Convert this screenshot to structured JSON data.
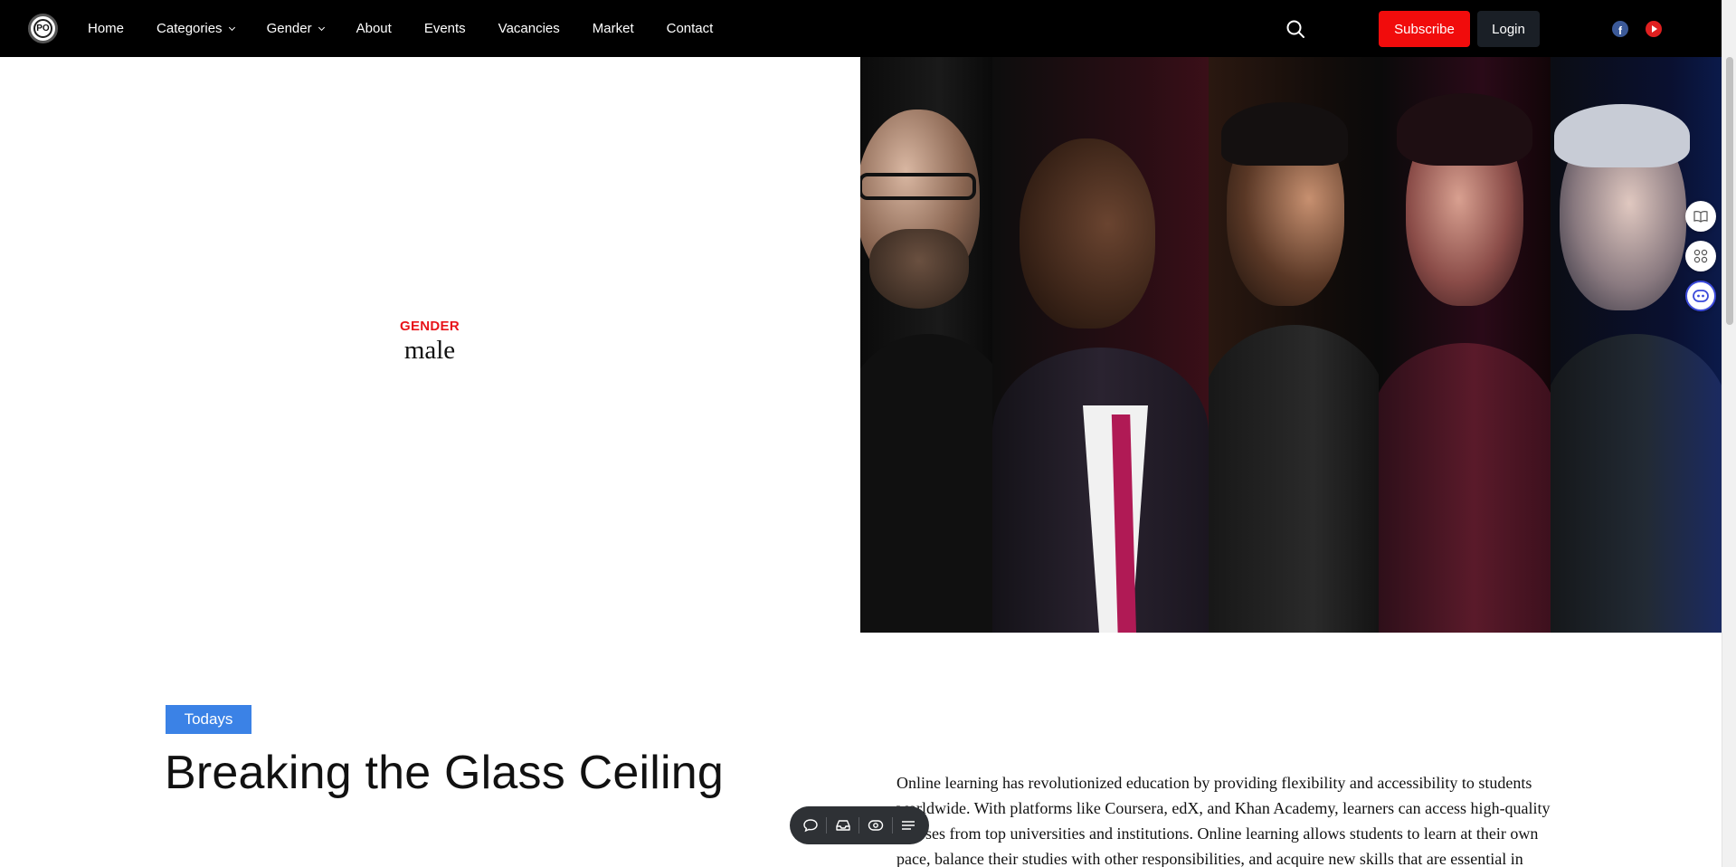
{
  "nav": {
    "logo_text": "PO",
    "items": [
      {
        "label": "Home",
        "dropdown": false
      },
      {
        "label": "Categories",
        "dropdown": true
      },
      {
        "label": "Gender",
        "dropdown": true
      },
      {
        "label": "About",
        "dropdown": false
      },
      {
        "label": "Events",
        "dropdown": false
      },
      {
        "label": "Vacancies",
        "dropdown": false
      },
      {
        "label": "Market",
        "dropdown": false
      },
      {
        "label": "Contact",
        "dropdown": false
      }
    ],
    "subscribe_label": "Subscribe",
    "login_label": "Login",
    "social": [
      "facebook-icon",
      "youtube-icon"
    ]
  },
  "hero": {
    "eyebrow": "GENDER",
    "title": "male"
  },
  "article": {
    "tag": "Todays",
    "title": "Breaking the Glass Ceiling",
    "body": "Online learning has revolutionized education by providing flexibility and accessibility to students worldwide. With platforms like Coursera, edX, and Khan Academy, learners can access high-quality courses from top universities and institutions. Online learning allows students to learn at their own pace, balance their studies with other responsibilities, and acquire new skills that are essential in"
  },
  "colors": {
    "nav_bg": "#000000",
    "subscribe_bg": "#f10c0c",
    "login_bg": "#1a1f26",
    "eyebrow": "#e8141a",
    "tag_bg": "#3b82e6"
  },
  "side_icons": [
    "book-icon",
    "apps-icon",
    "ai-assistant-icon"
  ],
  "toolbar_icons": [
    "chat-icon",
    "inbox-icon",
    "eye-icon",
    "menu-icon"
  ]
}
